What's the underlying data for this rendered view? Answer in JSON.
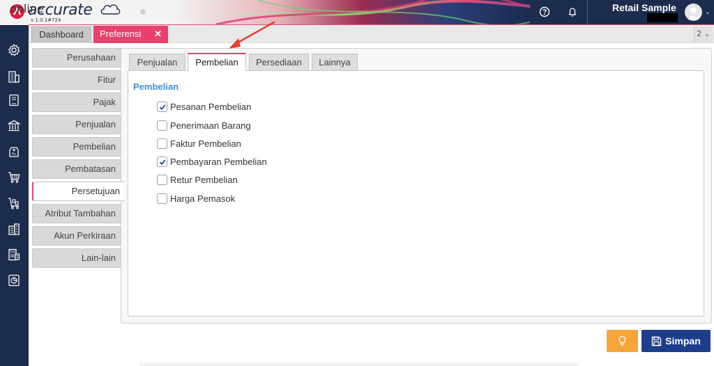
{
  "header": {
    "brand": "accurate",
    "brand_sub": "online",
    "version": "v 1.0.1#724",
    "company": "Retail Sample",
    "icons": [
      "help-icon",
      "bell-icon",
      "avatar-icon",
      "chevron-down-icon"
    ]
  },
  "tabs": {
    "dashboard": "Dashboard",
    "preferences": "Preferensi",
    "close": "✕",
    "count": "2 ⌄"
  },
  "sidebar_icons": [
    "gear-icon",
    "building-icon",
    "book-icon",
    "bank-icon",
    "tag-icon",
    "cart-icon",
    "inventory-cart-icon",
    "chart-building-icon",
    "tax-document-icon",
    "report-icon"
  ],
  "categories": [
    {
      "label": "Perusahaan"
    },
    {
      "label": "Fitur"
    },
    {
      "label": "Pajak"
    },
    {
      "label": "Penjualan"
    },
    {
      "label": "Pembelian"
    },
    {
      "label": "Pembatasan"
    },
    {
      "label": "Persetujuan",
      "active": true
    },
    {
      "label": "Atribut Tambahan"
    },
    {
      "label": "Akun Perkiraan"
    },
    {
      "label": "Lain-lain"
    }
  ],
  "subtabs": [
    {
      "label": "Penjualan"
    },
    {
      "label": "Pembelian",
      "active": true
    },
    {
      "label": "Persediaan"
    },
    {
      "label": "Lainnya"
    }
  ],
  "section": {
    "title": "Pembelian",
    "options": [
      {
        "label": "Pesanan Pembelian",
        "checked": true
      },
      {
        "label": "Penerimaan Barang",
        "checked": false
      },
      {
        "label": "Faktur Pembelian",
        "checked": false
      },
      {
        "label": "Pembayaran Pembelian",
        "checked": true
      },
      {
        "label": "Retur Pembelian",
        "checked": false
      },
      {
        "label": "Harga Pemasok",
        "checked": false
      }
    ]
  },
  "footer": {
    "save_label": "Simpan",
    "tip_icon": "lightbulb-icon",
    "save_icon": "floppy-disk-icon"
  },
  "colors": {
    "navy": "#1b2c4d",
    "pink": "#e8416d",
    "blue_title": "#3a8fd6",
    "save_blue": "#1e3e8c",
    "tip_orange": "#f6a538",
    "annotation_arrow": "#e5402f"
  }
}
